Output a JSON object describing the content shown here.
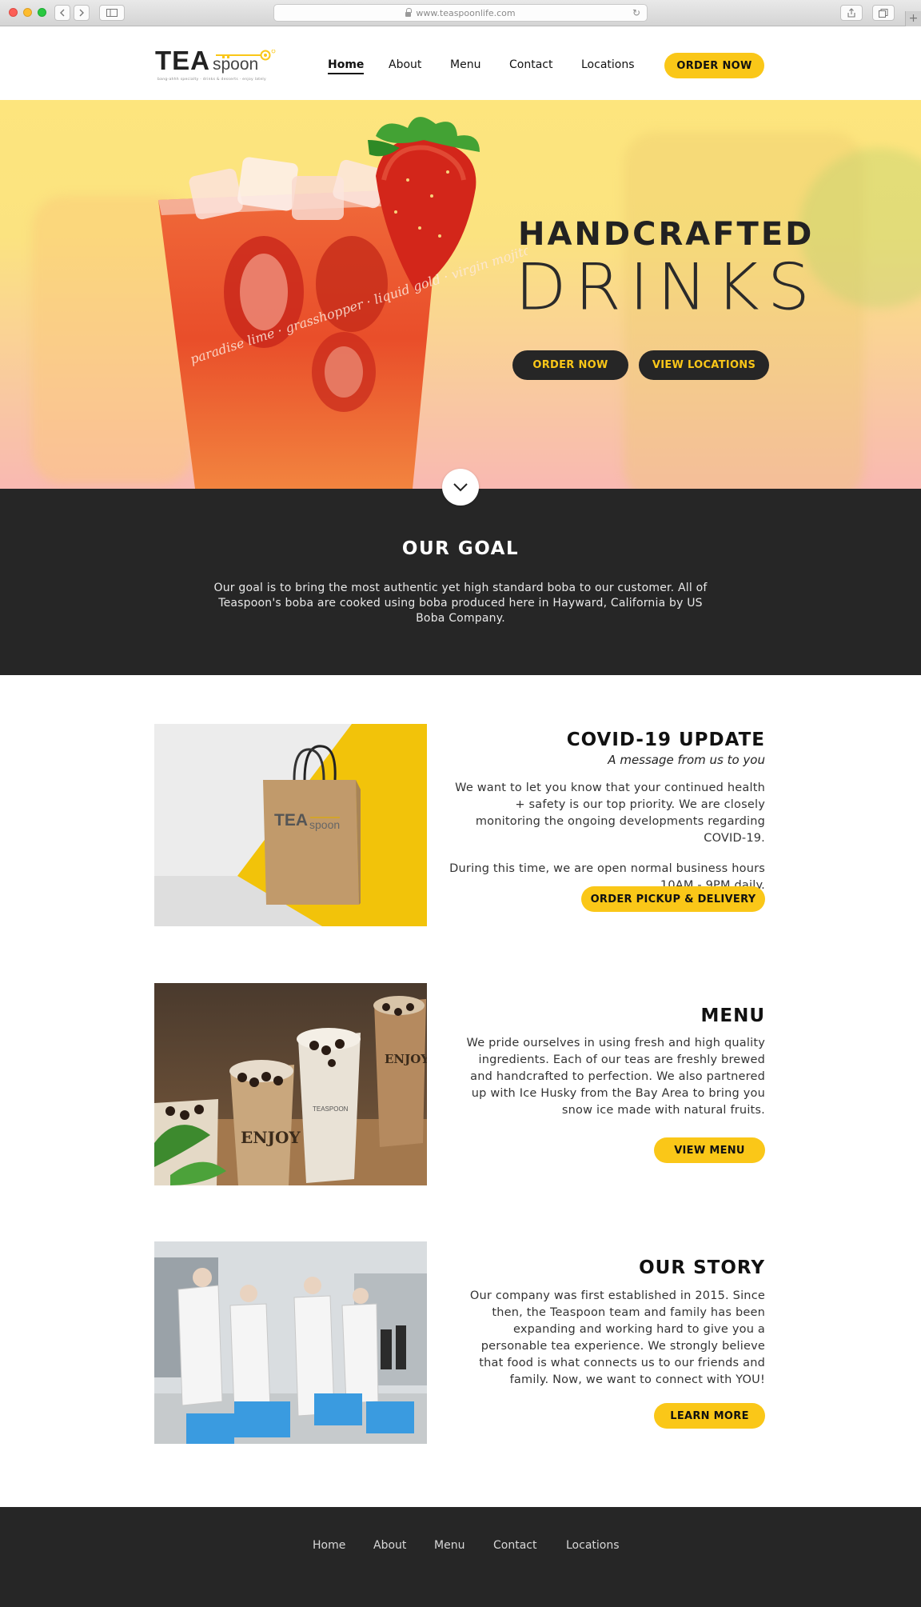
{
  "browser": {
    "url": "www.teaspoonlife.com"
  },
  "header": {
    "logo_word": "TEA",
    "logo_spoon": "spoon",
    "logo_tagline": "bang-ahhh specialty · drinks & desserts · enjoy lately",
    "nav": [
      {
        "label": "Home",
        "active": true
      },
      {
        "label": "About",
        "active": false
      },
      {
        "label": "Menu",
        "active": false
      },
      {
        "label": "Contact",
        "active": false
      },
      {
        "label": "Locations",
        "active": false
      }
    ],
    "order_button": "ORDER NOW"
  },
  "hero": {
    "title_line1": "HANDCRAFTED",
    "title_line2": "DRINKS",
    "order_button": "ORDER NOW",
    "locations_button": "VIEW LOCATIONS",
    "cup_script": "paradise lime · grasshopper · liquid gold · virgin mojito · sunrise"
  },
  "goal": {
    "title": "OUR GOAL",
    "body": "Our goal is to bring the most authentic yet high standard boba to our customer. All of Teaspoon's boba are cooked using boba produced here in Hayward, California by US Boba Company."
  },
  "covid": {
    "title": "COVID-19 UPDATE",
    "subtitle": "A message from us to you",
    "body1": "We want to let you know that your continued health + safety is our top priority. We are closely monitoring the ongoing developments regarding COVID-19.",
    "body2": "During this time, we are open normal business hours 10AM - 9PM daily.",
    "button": "ORDER PICKUP & DELIVERY",
    "bag_logo": "TEA spoon"
  },
  "menu": {
    "title": "MENU",
    "body": "We pride ourselves in using fresh and high quality ingredients. Each of our teas are freshly brewed and handcrafted to perfection. We also partnered up with Ice Husky from the Bay Area to bring you snow ice made with natural fruits.",
    "button": "VIEW MENU",
    "cup_text": "ENJOY LIFE ONE TEASPOON"
  },
  "story": {
    "title": "OUR STORY",
    "body": "Our company was first established in 2015. Since then, the Teaspoon team and family has been expanding and working hard to give you a personable tea experience. We strongly believe that food is what connects us to our friends and family. Now, we want to connect with YOU!",
    "button": "LEARN MORE"
  },
  "footer": {
    "nav": [
      "Home",
      "About",
      "Menu",
      "Contact",
      "Locations"
    ]
  },
  "colors": {
    "accent": "#fac718",
    "dark": "#262626"
  }
}
